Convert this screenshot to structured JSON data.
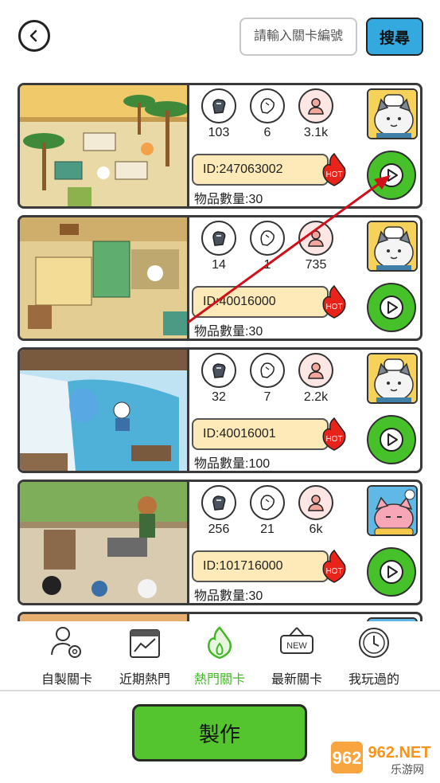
{
  "header": {
    "search_placeholder": "請輸入關卡編號",
    "search_button": "搜尋"
  },
  "levels": [
    {
      "likes": "103",
      "dislikes": "6",
      "players": "3.1k",
      "id_text": "ID:247063002",
      "hot": "HOT",
      "items_text": "物品數量:30",
      "theme": "desert",
      "avatar": "cat-chef"
    },
    {
      "likes": "14",
      "dislikes": "1",
      "players": "735",
      "id_text": "ID:40016000",
      "hot": "HOT",
      "items_text": "物品數量:30",
      "theme": "market",
      "avatar": "cat-chef"
    },
    {
      "likes": "32",
      "dislikes": "7",
      "players": "2.2k",
      "id_text": "ID:40016001",
      "hot": "HOT",
      "items_text": "物品數量:100",
      "theme": "snow",
      "avatar": "cat-chef"
    },
    {
      "likes": "256",
      "dislikes": "21",
      "players": "6k",
      "id_text": "ID:101716000",
      "hot": "HOT",
      "items_text": "物品數量:30",
      "theme": "village",
      "avatar": "cat-pink"
    }
  ],
  "tabs": [
    {
      "label": "自製關卡",
      "icon": "user-gear-icon"
    },
    {
      "label": "近期熱門",
      "icon": "chart-calendar-icon"
    },
    {
      "label": "熱門關卡",
      "icon": "flame-icon",
      "active": true
    },
    {
      "label": "最新關卡",
      "icon": "new-sign-icon"
    },
    {
      "label": "我玩過的",
      "icon": "clock-icon"
    }
  ],
  "make_button": "製作",
  "watermark": {
    "brand": "962.NET",
    "sub": "乐游网"
  },
  "colors": {
    "accent_green": "#46c12a",
    "search_blue": "#33a9e0",
    "id_pill": "#fdeab8",
    "hot_red": "#e8231a",
    "annotation_red": "#d0101a"
  }
}
